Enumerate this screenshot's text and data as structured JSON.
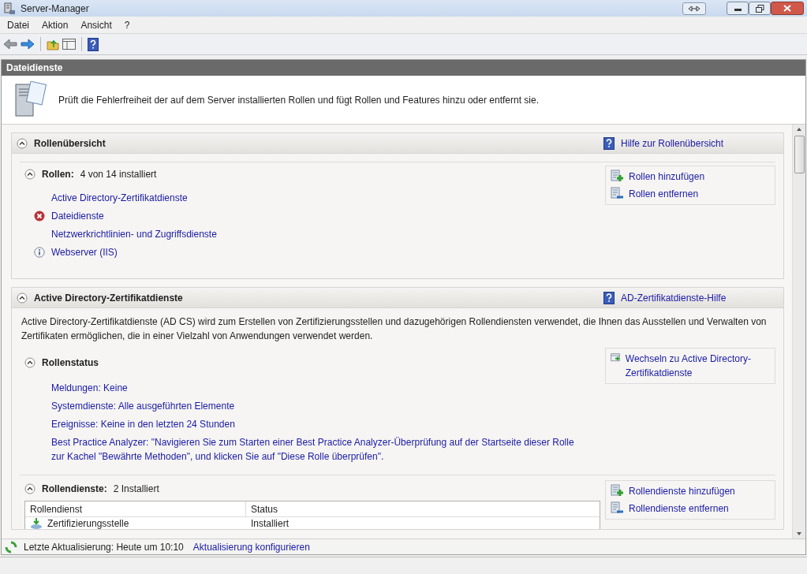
{
  "window": {
    "title": "Server-Manager"
  },
  "menu": [
    "Datei",
    "Aktion",
    "Ansicht",
    "?"
  ],
  "page_header": "Dateidienste",
  "description": "Prüft die Fehlerfreiheit der auf dem Server installierten Rollen und fügt Rollen und Features hinzu oder entfernt sie.",
  "role_summary": {
    "title": "Rollenübersicht",
    "help_link": "Hilfe zur Rollenübersicht",
    "roles": {
      "label": "Rollen:",
      "value": "4 von 14 installiert",
      "items": [
        {
          "name": "Active Directory-Zertifikatdienste",
          "kind": "plain"
        },
        {
          "name": "Dateidienste",
          "kind": "error"
        },
        {
          "name": "Netzwerkrichtlinien- und Zugriffsdienste",
          "kind": "plain"
        },
        {
          "name": "Webserver (IIS)",
          "kind": "info"
        }
      ],
      "actions": [
        {
          "label": "Rollen hinzufügen",
          "kind": "add"
        },
        {
          "label": "Rollen entfernen",
          "kind": "remove"
        }
      ]
    }
  },
  "adcs": {
    "title": "Active Directory-Zertifikatdienste",
    "help_link": "AD-Zertifikatdienste-Hilfe",
    "description": "Active Directory-Zertifikatdienste (AD CS) wird zum Erstellen von Zertifizierungsstellen und dazugehörigen Rollendiensten verwendet, die Ihnen das Ausstellen und Verwalten von Zertifikaten ermöglichen, die in einer Vielzahl von Anwendungen verwendet werden.",
    "role_status": {
      "title": "Rollenstatus",
      "links": [
        "Meldungen: Keine",
        "Systemdienste: Alle ausgeführten Elemente",
        "Ereignisse: Keine in den letzten 24 Stunden",
        "Best Practice Analyzer: \"Navigieren Sie zum Starten einer Best Practice Analyzer-Überprüfung auf der Startseite dieser Rolle zur Kachel \"Bewährte Methoden\", und klicken Sie auf \"Diese Rolle überprüfen\"."
      ],
      "actions": [
        {
          "label": "Wechseln zu Active Directory-Zertifikatdienste",
          "kind": "goto"
        }
      ]
    },
    "role_services": {
      "label": "Rollendienste:",
      "value": "2 Installiert",
      "actions": [
        {
          "label": "Rollendienste hinzufügen",
          "kind": "add"
        },
        {
          "label": "Rollendienste entfernen",
          "kind": "remove"
        }
      ],
      "table": {
        "columns": [
          "Rollendienst",
          "Status"
        ],
        "rows": [
          [
            "Zertifizierungsstelle",
            "Installiert"
          ]
        ]
      }
    }
  },
  "status": {
    "text": "Letzte Aktualisierung: Heute um 10:10",
    "link": "Aktualisierung konfigurieren"
  }
}
